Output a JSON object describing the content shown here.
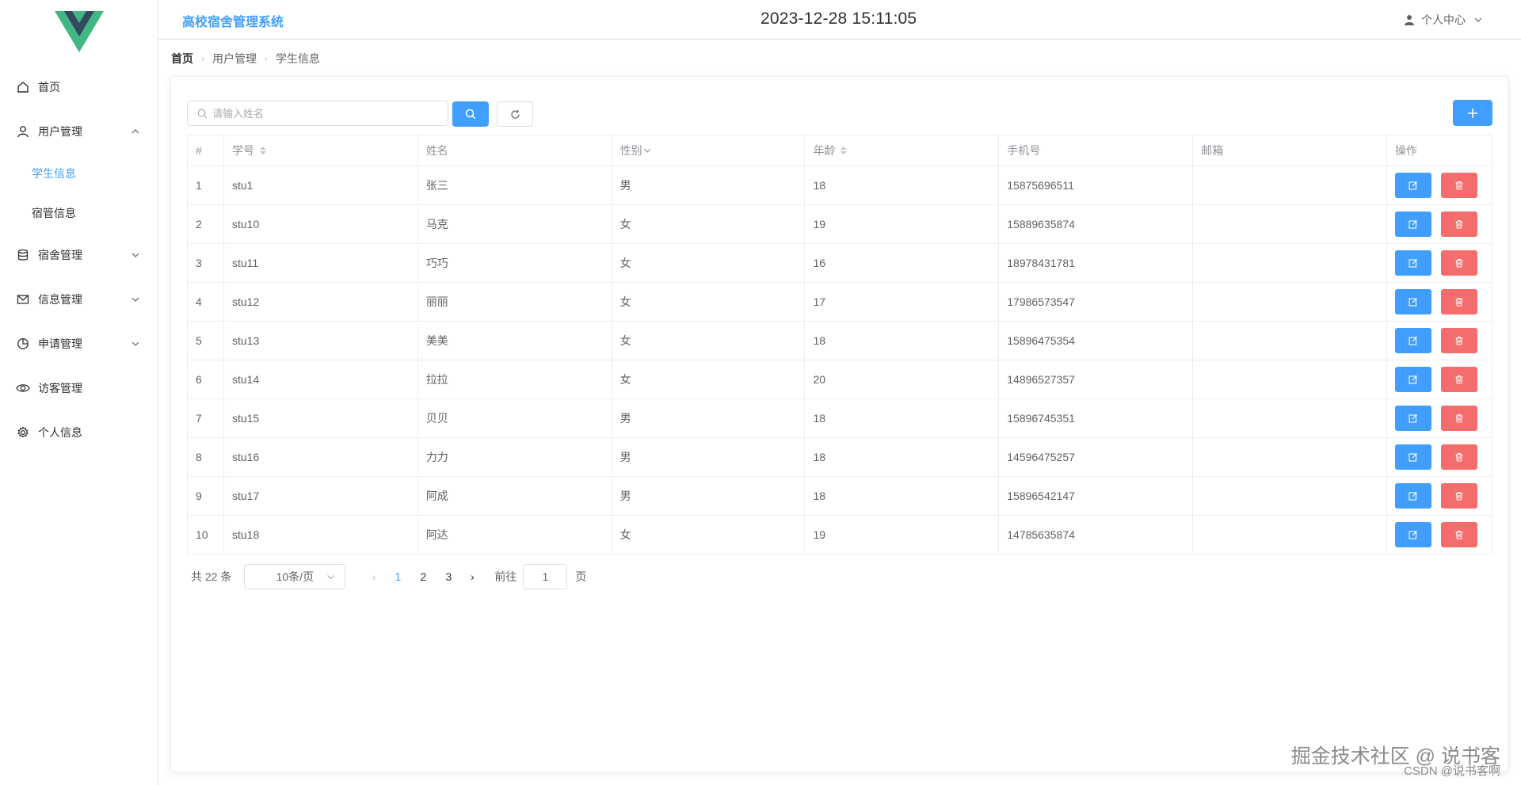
{
  "app": {
    "title": "高校宿舍管理系统",
    "datetime": "2023-12-28 15:11:05"
  },
  "user_menu": {
    "label": "个人中心",
    "icon": "user-icon"
  },
  "colors": {
    "primary": "#409eff",
    "danger": "#f56c6c",
    "logo_green": "#41b883",
    "logo_dark": "#35495e"
  },
  "sidebar": {
    "items": [
      {
        "label": "首页",
        "icon": "home-icon"
      },
      {
        "label": "用户管理",
        "icon": "user-icon",
        "expanded": true,
        "children": [
          {
            "label": "学生信息",
            "active": true
          },
          {
            "label": "宿管信息"
          }
        ]
      },
      {
        "label": "宿舍管理",
        "icon": "database-icon"
      },
      {
        "label": "信息管理",
        "icon": "message-icon"
      },
      {
        "label": "申请管理",
        "icon": "pie-chart-icon"
      },
      {
        "label": "访客管理",
        "icon": "eye-icon"
      },
      {
        "label": "个人信息",
        "icon": "gear-icon"
      }
    ]
  },
  "breadcrumb": [
    "首页",
    "用户管理",
    "学生信息"
  ],
  "search": {
    "placeholder": "请输入姓名",
    "value": ""
  },
  "table": {
    "columns": [
      "#",
      "学号",
      "姓名",
      "性别",
      "年龄",
      "手机号",
      "邮箱",
      "操作"
    ],
    "rows": [
      [
        "1",
        "stu1",
        "张三",
        "男",
        "18",
        "15875696511",
        ""
      ],
      [
        "2",
        "stu10",
        "马克",
        "女",
        "19",
        "15889635874",
        ""
      ],
      [
        "3",
        "stu11",
        "巧巧",
        "女",
        "16",
        "18978431781",
        ""
      ],
      [
        "4",
        "stu12",
        "丽丽",
        "女",
        "17",
        "17986573547",
        ""
      ],
      [
        "5",
        "stu13",
        "美美",
        "女",
        "18",
        "15896475354",
        ""
      ],
      [
        "6",
        "stu14",
        "拉拉",
        "女",
        "20",
        "14896527357",
        ""
      ],
      [
        "7",
        "stu15",
        "贝贝",
        "男",
        "18",
        "15896745351",
        ""
      ],
      [
        "8",
        "stu16",
        "力力",
        "男",
        "18",
        "14596475257",
        ""
      ],
      [
        "9",
        "stu17",
        "阿成",
        "男",
        "18",
        "15896542147",
        ""
      ],
      [
        "10",
        "stu18",
        "阿达",
        "女",
        "19",
        "14785635874",
        ""
      ]
    ]
  },
  "pagination": {
    "total_text": "共 22 条",
    "page_size": "10条/页",
    "pages": [
      "1",
      "2",
      "3"
    ],
    "current": "1",
    "goto_label": "前往",
    "goto_value": "1",
    "page_suffix": "页"
  },
  "watermark": {
    "line1": "掘金技术社区 @ 说书客",
    "line2": "CSDN @说书客啊"
  }
}
